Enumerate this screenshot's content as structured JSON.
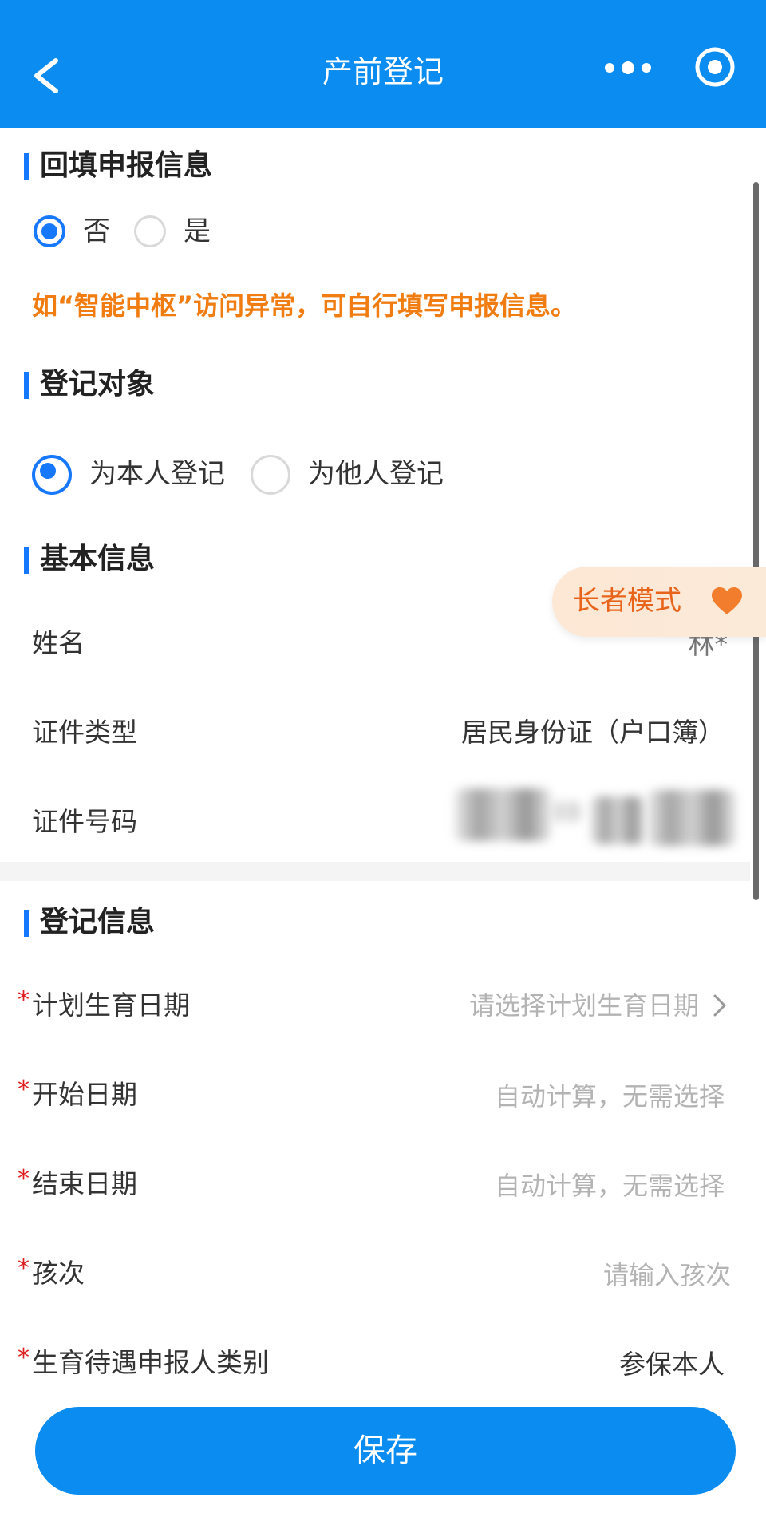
{
  "header": {
    "title": "产前登记"
  },
  "backfill": {
    "section_title": "回填申报信息",
    "options": [
      "否",
      "是"
    ],
    "selected": "否",
    "hint": "如“智能中枢”访问异常，可自行填写申报信息。"
  },
  "register_target": {
    "section_title": "登记对象",
    "options": [
      "为本人登记",
      "为他人登记"
    ],
    "selected": "为本人登记"
  },
  "basic_info": {
    "section_title": "基本信息",
    "rows": [
      {
        "label": "姓名",
        "value": "林*"
      },
      {
        "label": "证件类型",
        "value": "居民身份证（户口簿）"
      },
      {
        "label": "证件号码",
        "value": ""
      }
    ]
  },
  "elder_mode": {
    "label": "长者模式",
    "icon": "heart-icon"
  },
  "register_info": {
    "section_title": "登记信息",
    "rows": [
      {
        "label": "计划生育日期",
        "placeholder": "请选择计划生育日期"
      },
      {
        "label": "开始日期",
        "placeholder": "自动计算，无需选择"
      },
      {
        "label": "结束日期",
        "placeholder": "自动计算，无需选择"
      },
      {
        "label": "孩次",
        "placeholder": "请输入孩次"
      },
      {
        "label": "生育待遇申报人类别",
        "value": "参保本人"
      }
    ],
    "required_mark": "*"
  },
  "footer": {
    "save_label": "保存"
  },
  "colors": {
    "primary": "#0a8cf0",
    "hint": "#f07c12",
    "required": "#e02020"
  }
}
